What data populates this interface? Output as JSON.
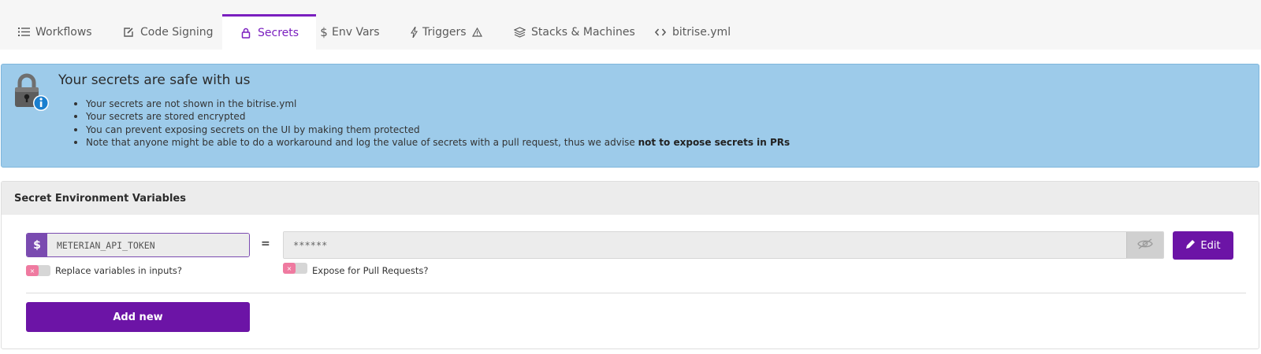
{
  "tabs": [
    {
      "label": "Workflows",
      "icon": "list-icon"
    },
    {
      "label": "Code Signing",
      "icon": "edit-square-icon"
    },
    {
      "label": "Secrets",
      "icon": "lock-icon",
      "active": true
    },
    {
      "label": "Env Vars",
      "icon": "dollar-icon"
    },
    {
      "label": "Triggers",
      "icon": "lightning-icon",
      "badge_icon": "warning-icon"
    },
    {
      "label": "Stacks & Machines",
      "icon": "layers-icon"
    },
    {
      "label": "bitrise.yml",
      "icon": "code-icon"
    }
  ],
  "banner": {
    "title": "Your secrets are safe with us",
    "items": [
      "Your secrets are not shown in the bitrise.yml",
      "Your secrets are stored encrypted",
      "You can prevent exposing secrets on the UI by making them protected"
    ],
    "last_item_prefix": "Note that anyone might be able to do a workaround and log the value of secrets with a pull request, thus we advise ",
    "last_item_bold": "not to expose secrets in PRs",
    "icon": "padlock-info-icon",
    "background": "#9dcbea"
  },
  "panel": {
    "title": "Secret Environment Variables",
    "key_prefix": "$",
    "key_value": "METERIAN_API_TOKEN",
    "equals": "=",
    "secret_value": "******",
    "edit_label": "Edit",
    "replace_toggle_label": "Replace variables in inputs?",
    "expose_toggle_label": "Expose for Pull Requests?",
    "toggle_off_glyph": "×",
    "add_new_label": "Add new"
  },
  "colors": {
    "accent": "#6c14a6",
    "active_tab": "#7a1fbf",
    "toggle_off": "#ef7aa0"
  }
}
